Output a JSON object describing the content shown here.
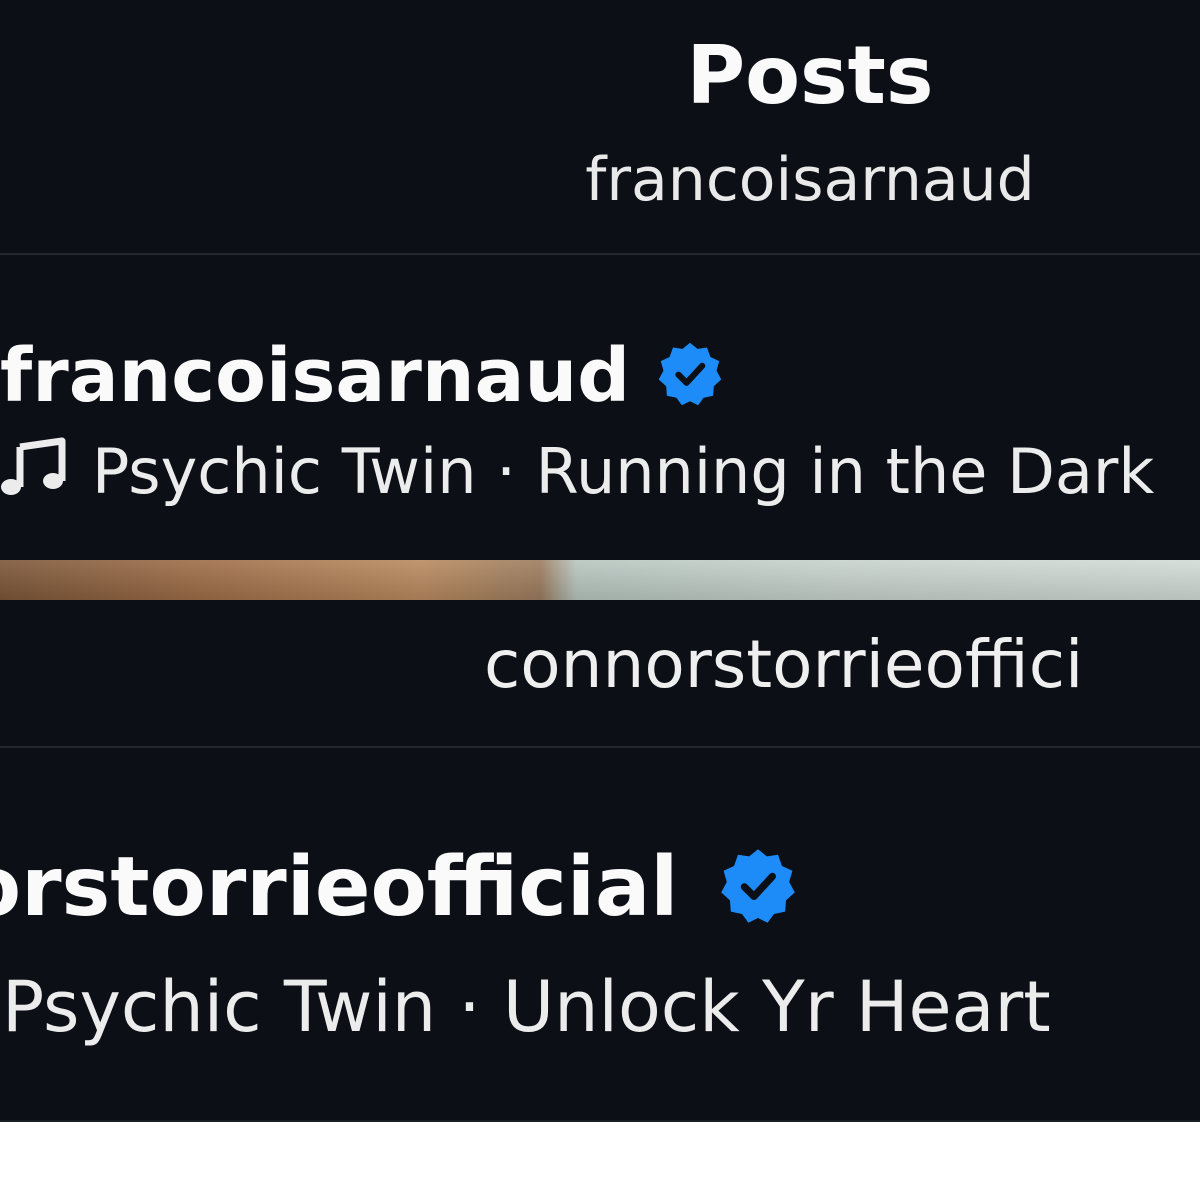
{
  "header": {
    "title": "Posts",
    "subtitle": "francoisarnaud"
  },
  "post_1": {
    "username": "francoisarnaud",
    "verified_icon": "verified-badge-icon",
    "music_icon": "music-note-icon",
    "audio": "Psychic Twin · Running in the Dark"
  },
  "header_2": {
    "subtitle": "connorstorrieoffici"
  },
  "post_2": {
    "username": "nnorstorrieofficial",
    "verified_icon": "verified-badge-icon",
    "audio": "Psychic Twin · Unlock Yr Heart"
  },
  "colors": {
    "background": "#0c1016",
    "verified_blue": "#1d8cf8",
    "text": "#fafafa"
  }
}
